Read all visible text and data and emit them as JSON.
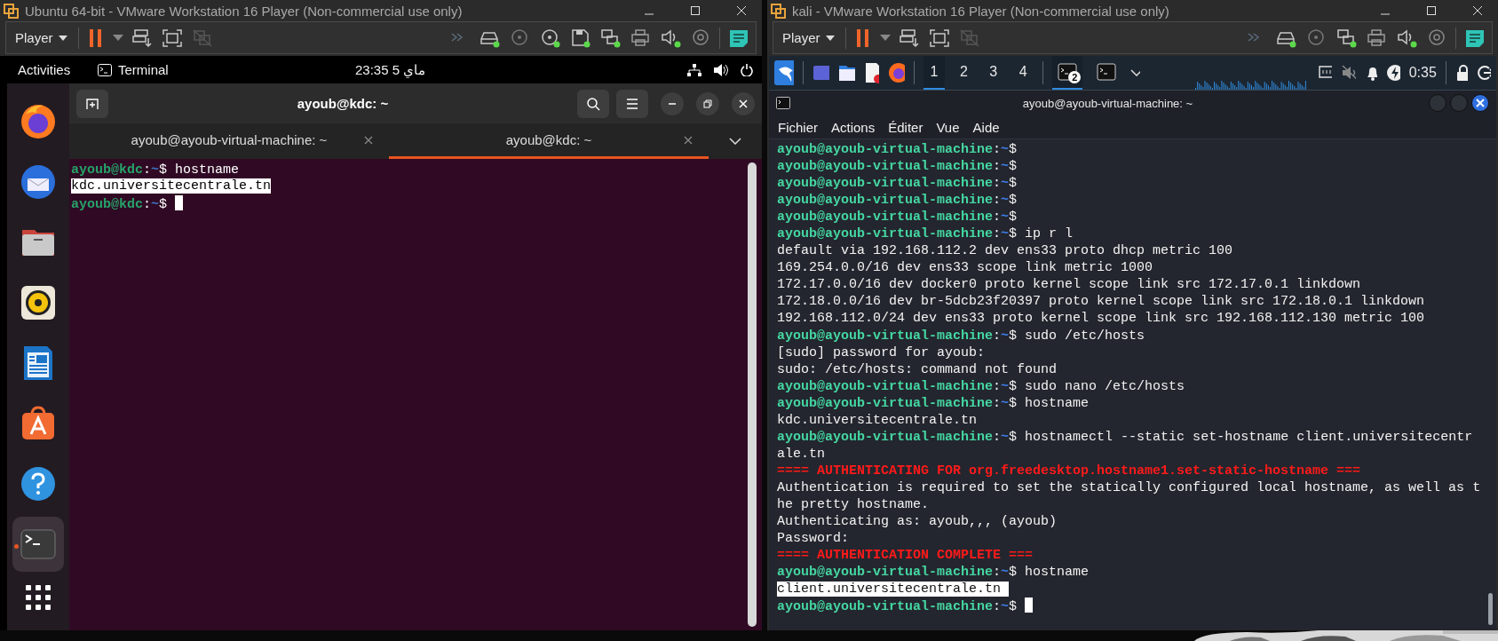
{
  "left_vm": {
    "title": "Ubuntu 64-bit - VMware Workstation 16 Player (Non-commercial use only)",
    "player_menu": "Player",
    "devices": [
      {
        "kind": "forward",
        "connected": false
      },
      {
        "kind": "disk",
        "connected": true
      },
      {
        "kind": "cd",
        "connected": false
      },
      {
        "kind": "cd",
        "connected": true
      },
      {
        "kind": "floppy",
        "connected": true
      },
      {
        "kind": "network",
        "connected": true
      },
      {
        "kind": "printer",
        "connected": false
      },
      {
        "kind": "sound",
        "connected": true
      },
      {
        "kind": "usb",
        "connected": false
      }
    ],
    "top_bar": {
      "activities": "Activities",
      "app_name": "Terminal",
      "clock": "23:35  5 ماي"
    },
    "dock": [
      {
        "running": false
      },
      {
        "running": false
      },
      {
        "running": false
      },
      {
        "running": false
      },
      {
        "running": false
      },
      {
        "running": false
      },
      {
        "running": false
      },
      {
        "running": true
      }
    ],
    "terminal": {
      "title": "ayoub@kdc: ~",
      "tabs": [
        {
          "label": "ayoub@ayoub-virtual-machine: ~",
          "selected": false
        },
        {
          "label": "ayoub@kdc: ~",
          "selected": true
        }
      ],
      "lines": [
        {
          "kind": "prompt",
          "user": "ayoub@kdc",
          "colon": ":",
          "path": "~",
          "dollar": "$",
          "command": "hostname",
          "cursor": false
        },
        {
          "kind": "output",
          "text": "kdc.universitecentrale.tn",
          "selected": true
        },
        {
          "kind": "prompt",
          "user": "ayoub@kdc",
          "colon": ":",
          "path": "~",
          "dollar": "$",
          "cursor": true
        }
      ]
    }
  },
  "right_vm": {
    "title": "kali - VMware Workstation 16 Player (Non-commercial use only)",
    "player_menu": "Player",
    "devices": [
      {
        "kind": "forward",
        "connected": false
      },
      {
        "kind": "disk",
        "connected": true
      },
      {
        "kind": "cd",
        "connected": false
      },
      {
        "kind": "network",
        "connected": true
      },
      {
        "kind": "printer",
        "connected": false
      },
      {
        "kind": "sound",
        "connected": true
      },
      {
        "kind": "usb",
        "connected": false
      }
    ],
    "panel": {
      "workspaces": [
        {
          "label": "1",
          "selected": true
        },
        {
          "label": "2",
          "selected": false
        },
        {
          "label": "3",
          "selected": false
        },
        {
          "label": "4",
          "selected": false
        }
      ],
      "tasks": [
        {
          "badge": "2",
          "selected": true
        },
        {
          "selected": false
        }
      ],
      "clock": "0:35"
    },
    "terminal": {
      "title": "ayoub@ayoub-virtual-machine: ~",
      "menu": [
        "Fichier",
        "Actions",
        "Éditer",
        "Vue",
        "Aide"
      ],
      "lines": [
        {
          "kind": "prompt",
          "user": "ayoub@ayoub-virtual-machine",
          "colon": ":",
          "path": "~",
          "dollar": "$",
          "cursor": false
        },
        {
          "kind": "prompt",
          "user": "ayoub@ayoub-virtual-machine",
          "colon": ":",
          "path": "~",
          "dollar": "$",
          "cursor": false
        },
        {
          "kind": "prompt",
          "user": "ayoub@ayoub-virtual-machine",
          "colon": ":",
          "path": "~",
          "dollar": "$",
          "cursor": false
        },
        {
          "kind": "prompt",
          "user": "ayoub@ayoub-virtual-machine",
          "colon": ":",
          "path": "~",
          "dollar": "$",
          "cursor": false
        },
        {
          "kind": "prompt",
          "user": "ayoub@ayoub-virtual-machine",
          "colon": ":",
          "path": "~",
          "dollar": "$",
          "cursor": false
        },
        {
          "kind": "prompt",
          "user": "ayoub@ayoub-virtual-machine",
          "colon": ":",
          "path": "~",
          "dollar": "$",
          "command": "ip r l",
          "cursor": false
        },
        {
          "kind": "output",
          "text": "default via 192.168.112.2 dev ens33 proto dhcp metric 100",
          "selected": false
        },
        {
          "kind": "output",
          "text": "169.254.0.0/16 dev ens33 scope link metric 1000",
          "selected": false
        },
        {
          "kind": "output",
          "text": "172.17.0.0/16 dev docker0 proto kernel scope link src 172.17.0.1 linkdown",
          "selected": false
        },
        {
          "kind": "output",
          "text": "172.18.0.0/16 dev br-5dcb23f20397 proto kernel scope link src 172.18.0.1 linkdown",
          "selected": false
        },
        {
          "kind": "output",
          "text": "192.168.112.0/24 dev ens33 proto kernel scope link src 192.168.112.130 metric 100",
          "selected": false
        },
        {
          "kind": "prompt",
          "user": "ayoub@ayoub-virtual-machine",
          "colon": ":",
          "path": "~",
          "dollar": "$",
          "command": "sudo /etc/hosts",
          "cursor": false
        },
        {
          "kind": "output",
          "text": "[sudo] password for ayoub:",
          "selected": false
        },
        {
          "kind": "output",
          "text": "sudo: /etc/hosts: command not found",
          "selected": false
        },
        {
          "kind": "prompt",
          "user": "ayoub@ayoub-virtual-machine",
          "colon": ":",
          "path": "~",
          "dollar": "$",
          "command": "sudo nano /etc/hosts",
          "cursor": false
        },
        {
          "kind": "prompt",
          "user": "ayoub@ayoub-virtual-machine",
          "colon": ":",
          "path": "~",
          "dollar": "$",
          "command": "hostname",
          "cursor": false
        },
        {
          "kind": "output",
          "text": "kdc.universitecentrale.tn",
          "selected": false
        },
        {
          "kind": "prompt",
          "user": "ayoub@ayoub-virtual-machine",
          "colon": ":",
          "path": "~",
          "dollar": "$",
          "command": "hostnamectl --static set-hostname client.universitecentrale.tn",
          "cursor": false
        },
        {
          "kind": "alert",
          "text": "==== AUTHENTICATING FOR org.freedesktop.hostname1.set-static-hostname ==="
        },
        {
          "kind": "output",
          "text": "Authentication is required to set the statically configured local hostname, as well as the pretty hostname.",
          "selected": false
        },
        {
          "kind": "output",
          "text": "Authenticating as: ayoub,,, (ayoub)",
          "selected": false
        },
        {
          "kind": "output",
          "text": "Password:",
          "selected": false
        },
        {
          "kind": "alert",
          "text": "==== AUTHENTICATION COMPLETE ==="
        },
        {
          "kind": "prompt",
          "user": "ayoub@ayoub-virtual-machine",
          "colon": ":",
          "path": "~",
          "dollar": "$",
          "command": "hostname",
          "cursor": false
        },
        {
          "kind": "output",
          "text": "client.universitecentrale.tn ",
          "selected": true
        },
        {
          "kind": "prompt",
          "user": "ayoub@ayoub-virtual-machine",
          "colon": ":",
          "path": "~",
          "dollar": "$",
          "cursor": true
        }
      ]
    }
  }
}
